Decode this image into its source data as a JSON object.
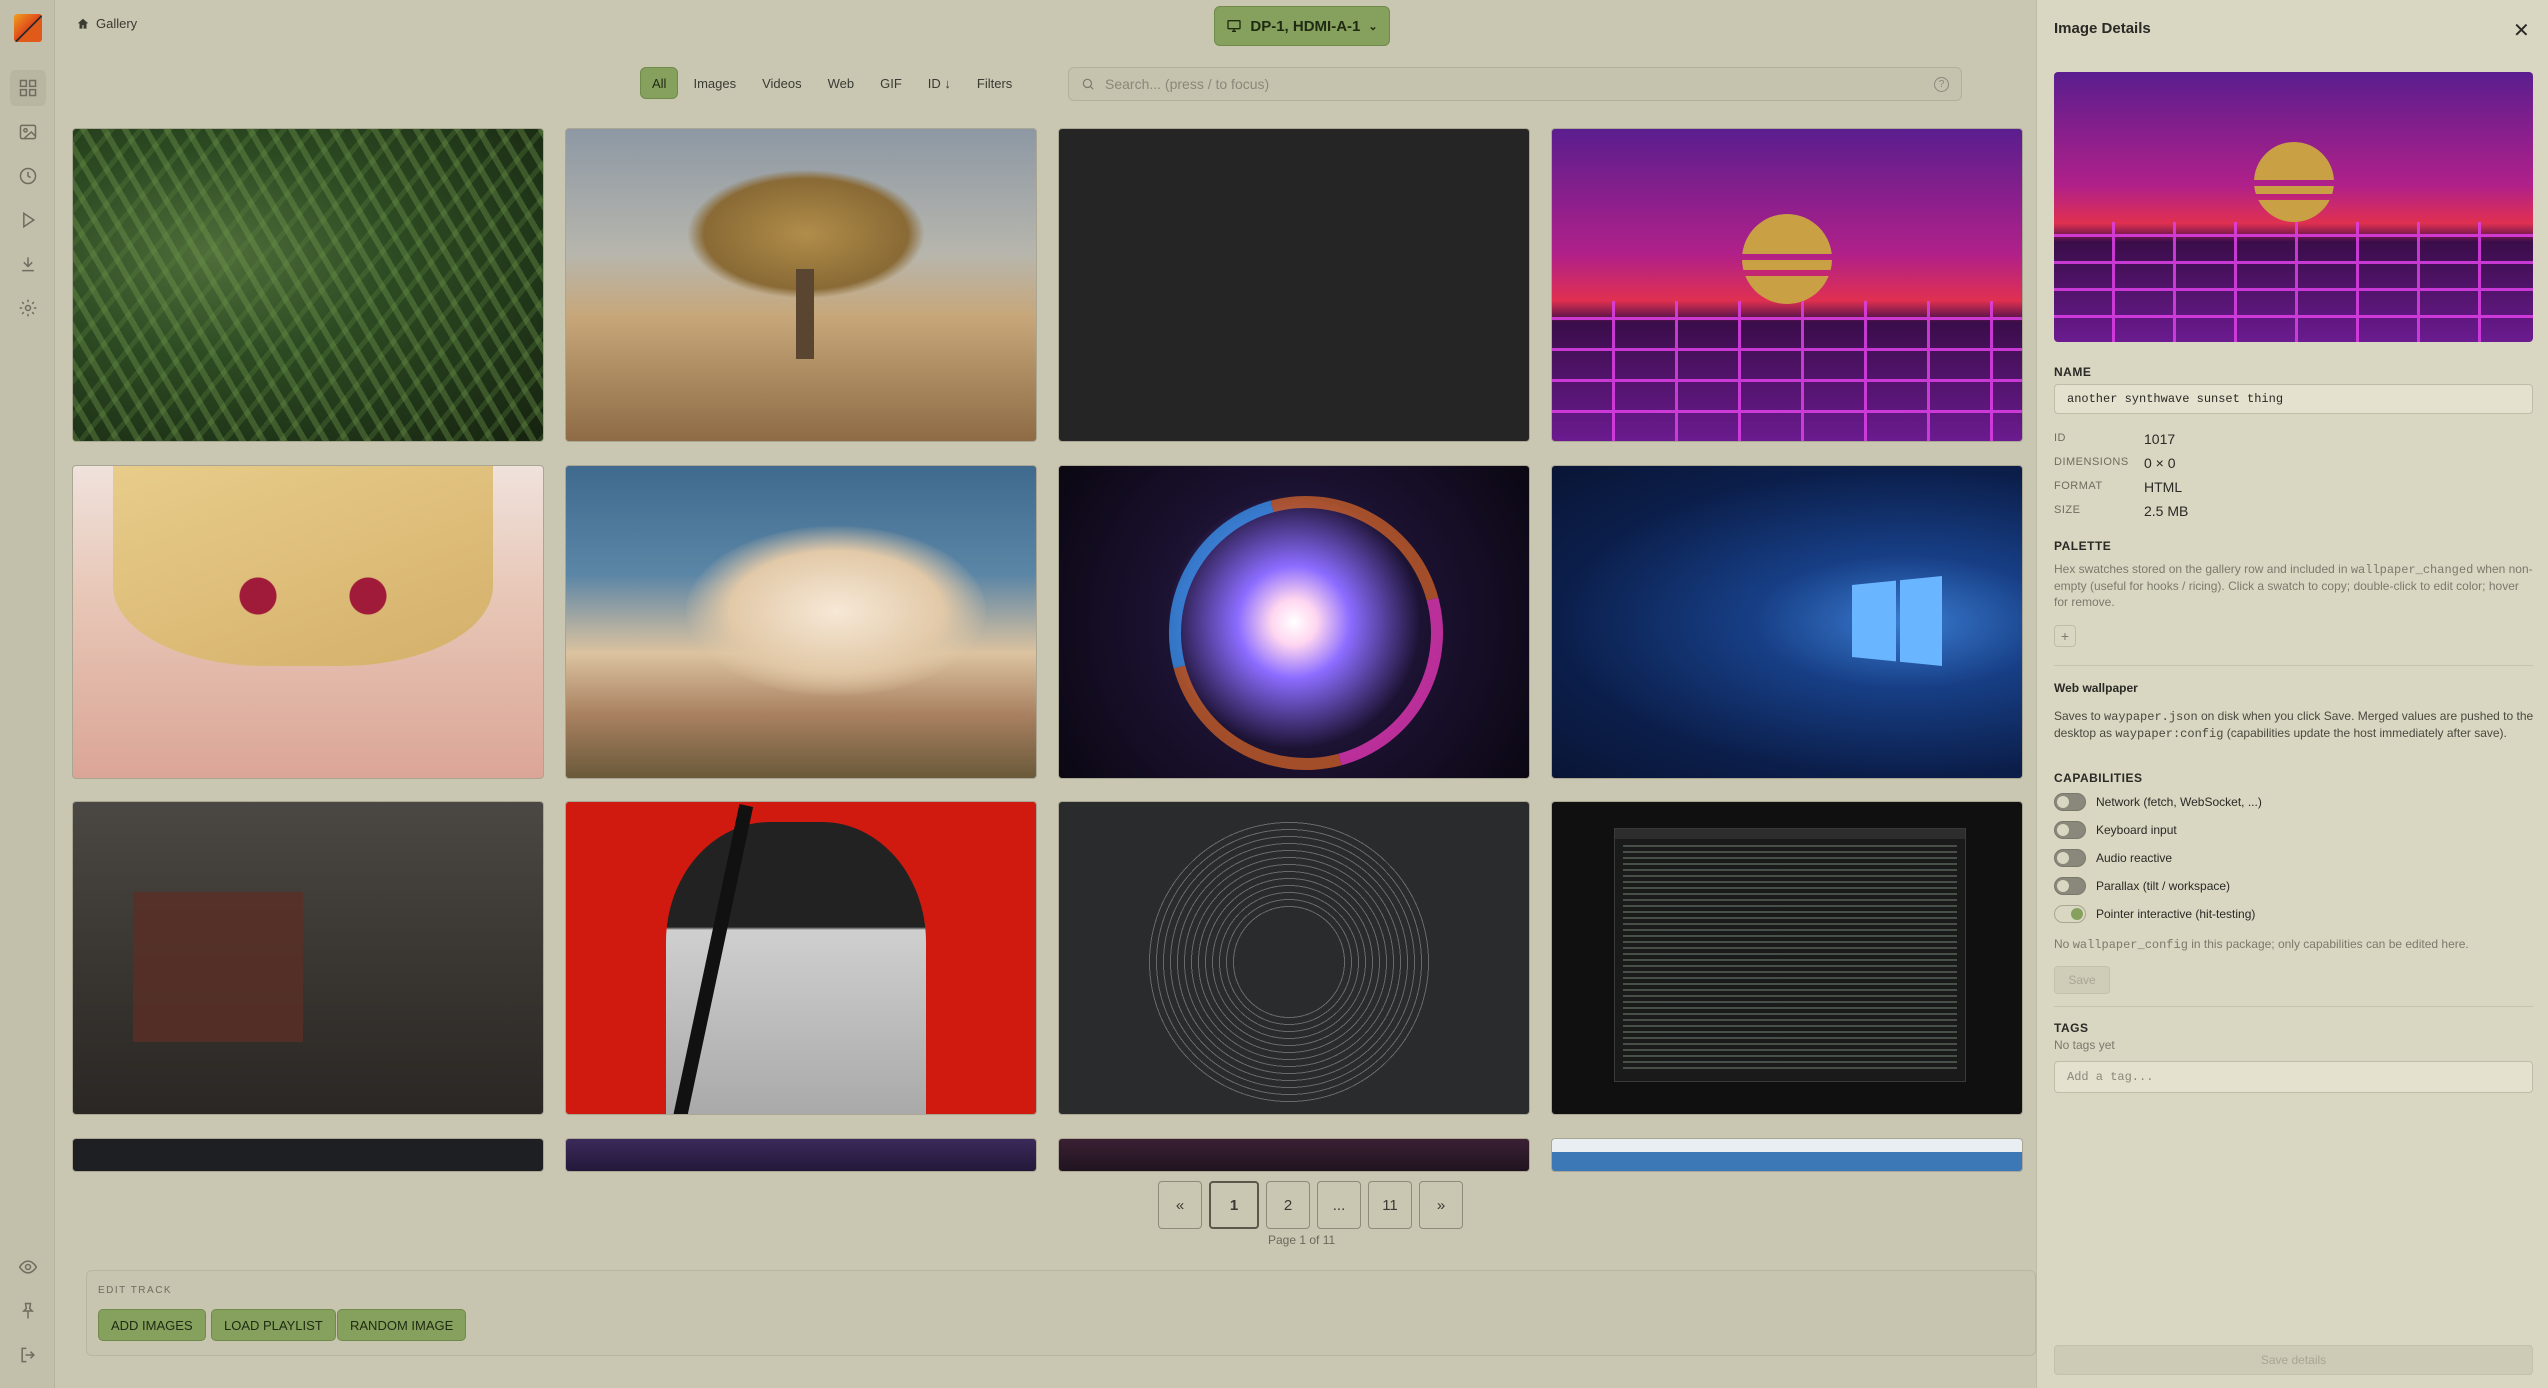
{
  "breadcrumb": {
    "label": "Gallery",
    "icon": "home-icon"
  },
  "monitor": {
    "label": "DP-1, HDMI-A-1",
    "icon": "monitor-icon"
  },
  "filters": [
    {
      "label": "All",
      "active": true
    },
    {
      "label": "Images"
    },
    {
      "label": "Videos"
    },
    {
      "label": "Web"
    },
    {
      "label": "GIF"
    },
    {
      "label": "ID ↓"
    },
    {
      "label": "Filters"
    }
  ],
  "search": {
    "placeholder": "Search... (press / to focus)",
    "help": "?"
  },
  "sidebar": {
    "items": [
      {
        "icon": "grid-icon",
        "active": true
      },
      {
        "icon": "image-icon"
      },
      {
        "icon": "clock-icon"
      },
      {
        "icon": "play-icon"
      },
      {
        "icon": "download-icon"
      },
      {
        "icon": "gear-icon"
      }
    ],
    "bottom": [
      {
        "icon": "eye-icon"
      },
      {
        "icon": "pin-icon"
      },
      {
        "icon": "logout-icon"
      }
    ]
  },
  "pagination": {
    "prev": "«",
    "pages": [
      "1",
      "2",
      "...",
      "11"
    ],
    "current": "1",
    "next": "»",
    "info": "Page 1 of 11"
  },
  "edit_track": {
    "label": "EDIT TRACK",
    "buttons": [
      "ADD IMAGES",
      "LOAD PLAYLIST",
      "RANDOM IMAGE"
    ]
  },
  "details": {
    "title": "Image Details",
    "close": "✕",
    "name_label": "NAME",
    "name_value": "another synthwave sunset thing",
    "fields": [
      {
        "key": "ID",
        "value": "1017"
      },
      {
        "key": "DIMENSIONS",
        "value": "0 × 0"
      },
      {
        "key": "FORMAT",
        "value": "HTML"
      },
      {
        "key": "SIZE",
        "value": "2.5 MB"
      }
    ],
    "palette_label": "PALETTE",
    "palette_desc_1": "Hex swatches stored on the gallery row and included in ",
    "palette_desc_code": "wallpaper_changed",
    "palette_desc_2": " when non-empty (useful for hooks / ricing). Click a swatch to copy; double-click to edit color; hover for remove.",
    "palette_add": "+",
    "web_title": "Web wallpaper",
    "web_desc_1": "Saves to ",
    "web_desc_code1": "waypaper.json",
    "web_desc_2": " on disk when you click Save. Merged values are pushed to the desktop as ",
    "web_desc_code2": "waypaper:config",
    "web_desc_3": " (capabilities update the host immediately after save).",
    "capabilities_label": "CAPABILITIES",
    "capabilities": [
      {
        "label": "Network (fetch, WebSocket, ...)",
        "on": false
      },
      {
        "label": "Keyboard input",
        "on": false
      },
      {
        "label": "Audio reactive",
        "on": false
      },
      {
        "label": "Parallax (tilt / workspace)",
        "on": false
      },
      {
        "label": "Pointer interactive (hit-testing)",
        "on": true
      }
    ],
    "config_note_1": "No ",
    "config_note_code": "wallpaper_config",
    "config_note_2": " in this package; only capabilities can be edited here.",
    "save": "Save",
    "tags_label": "TAGS",
    "tags_empty": "No tags yet",
    "tag_placeholder": "Add a tag...",
    "save_details": "Save details"
  },
  "colors": {
    "accent": "#86a05e",
    "background": "#c9c6b1",
    "panel": "#d9d6c2"
  }
}
